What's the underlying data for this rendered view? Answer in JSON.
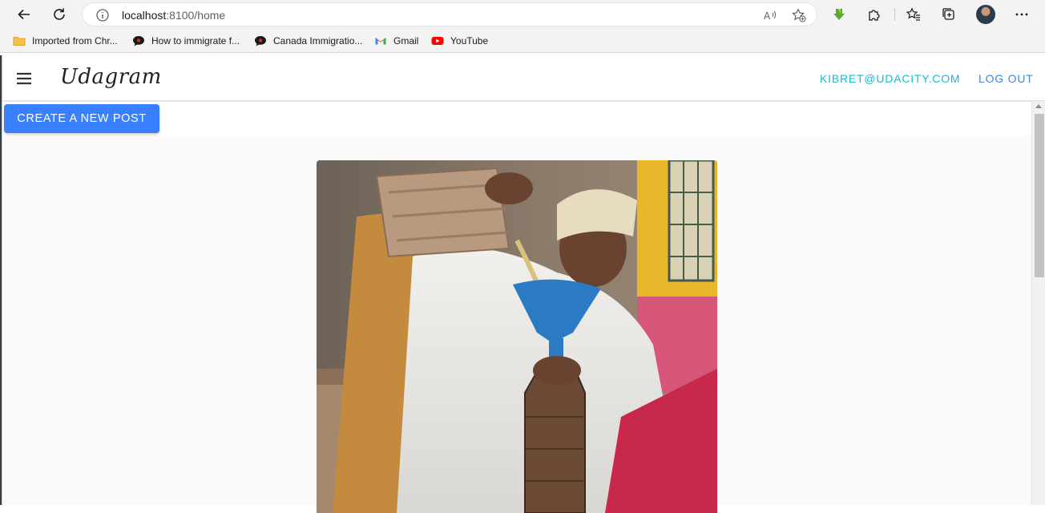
{
  "browser": {
    "url_host": "localhost",
    "url_path": ":8100/home",
    "bookmarks": [
      {
        "label": "Imported from Chr...",
        "icon": "folder-icon"
      },
      {
        "label": "How to immigrate f...",
        "icon": "chat-bubble-icon"
      },
      {
        "label": "Canada Immigratio...",
        "icon": "chat-bubble-icon"
      },
      {
        "label": "Gmail",
        "icon": "gmail-icon"
      },
      {
        "label": "YouTube",
        "icon": "youtube-icon"
      }
    ]
  },
  "app": {
    "brand": "Udagram",
    "user_email": "KIBRET@UDACITY.COM",
    "logout_label": "LOG OUT",
    "create_post_label": "CREATE A NEW POST",
    "colors": {
      "primary": "#3880ff",
      "email_link": "#1ab8d6",
      "logout_link": "#3b85e0"
    }
  }
}
